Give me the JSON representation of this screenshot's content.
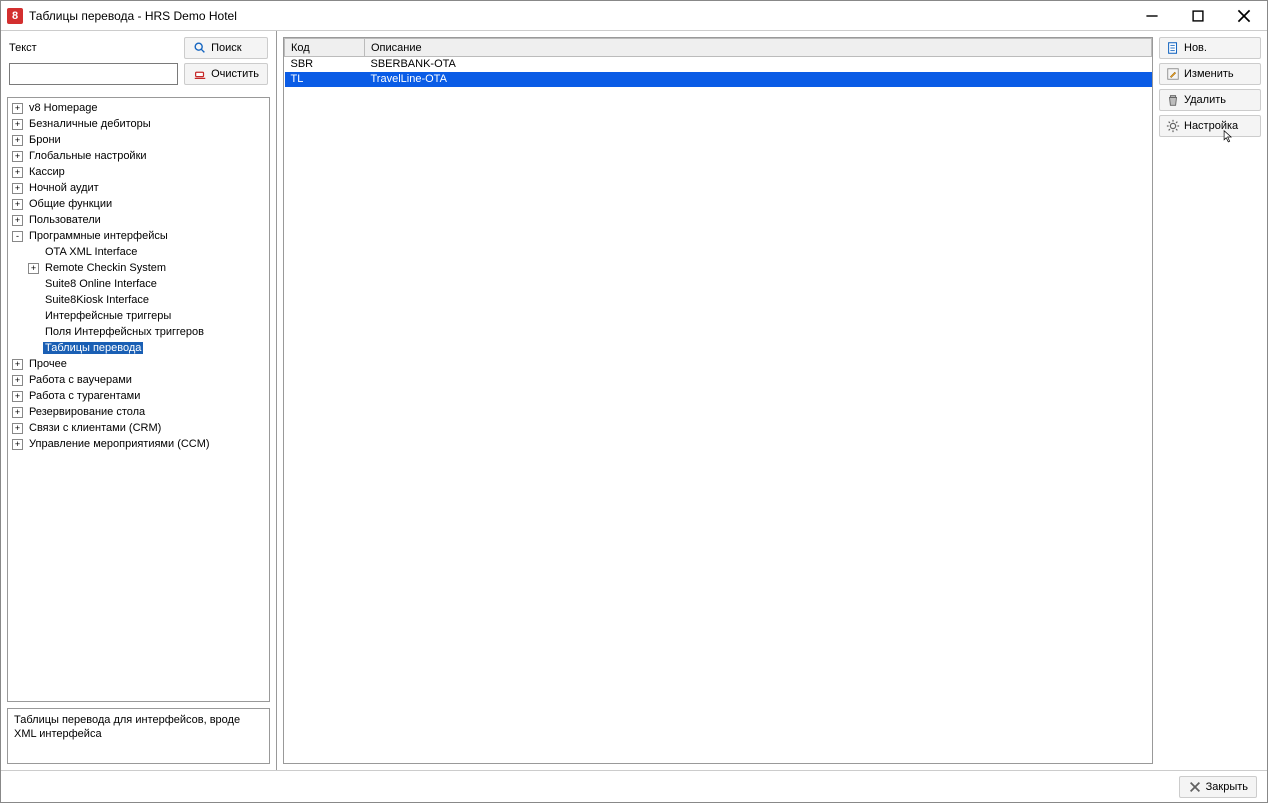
{
  "window": {
    "title": "Таблицы перевода - HRS Demo Hotel",
    "app_icon_text": "8"
  },
  "search": {
    "label": "Текст",
    "search_btn": "Поиск",
    "clear_btn": "Очистить",
    "value": ""
  },
  "tree": {
    "items": [
      {
        "label": "v8 Homepage"
      },
      {
        "label": "Безналичные дебиторы"
      },
      {
        "label": "Брони"
      },
      {
        "label": "Глобальные настройки"
      },
      {
        "label": "Кассир"
      },
      {
        "label": "Ночной аудит"
      },
      {
        "label": "Общие функции"
      },
      {
        "label": "Пользователи"
      },
      {
        "label": "Программные интерфейсы",
        "children": [
          {
            "label": "OTA XML Interface"
          },
          {
            "label": "Remote Checkin System",
            "expander": "+"
          },
          {
            "label": "Suite8 Online Interface"
          },
          {
            "label": "Suite8Kiosk Interface"
          },
          {
            "label": "Интерфейсные триггеры"
          },
          {
            "label": "Поля Интерфейсных триггеров"
          },
          {
            "label": "Таблицы перевода",
            "selected": true
          }
        ]
      },
      {
        "label": "Прочее"
      },
      {
        "label": "Работа с ваучерами"
      },
      {
        "label": "Работа с турагентами"
      },
      {
        "label": "Резервирование стола"
      },
      {
        "label": "Связи с клиентами (CRM)"
      },
      {
        "label": "Управление мероприятиями (CCM)"
      }
    ]
  },
  "description": "Таблицы перевода для интерфейсов, вроде XML интерфейса",
  "table": {
    "headers": {
      "code": "Код",
      "desc": "Описание"
    },
    "rows": [
      {
        "code": "SBR",
        "desc": "SBERBANK-OTA",
        "selected": false
      },
      {
        "code": "TL",
        "desc": "TravelLine-OTA",
        "selected": true
      }
    ]
  },
  "actions": {
    "new": "Нов.",
    "edit": "Изменить",
    "delete": "Удалить",
    "setup": "Настройка"
  },
  "footer": {
    "close": "Закрыть"
  }
}
